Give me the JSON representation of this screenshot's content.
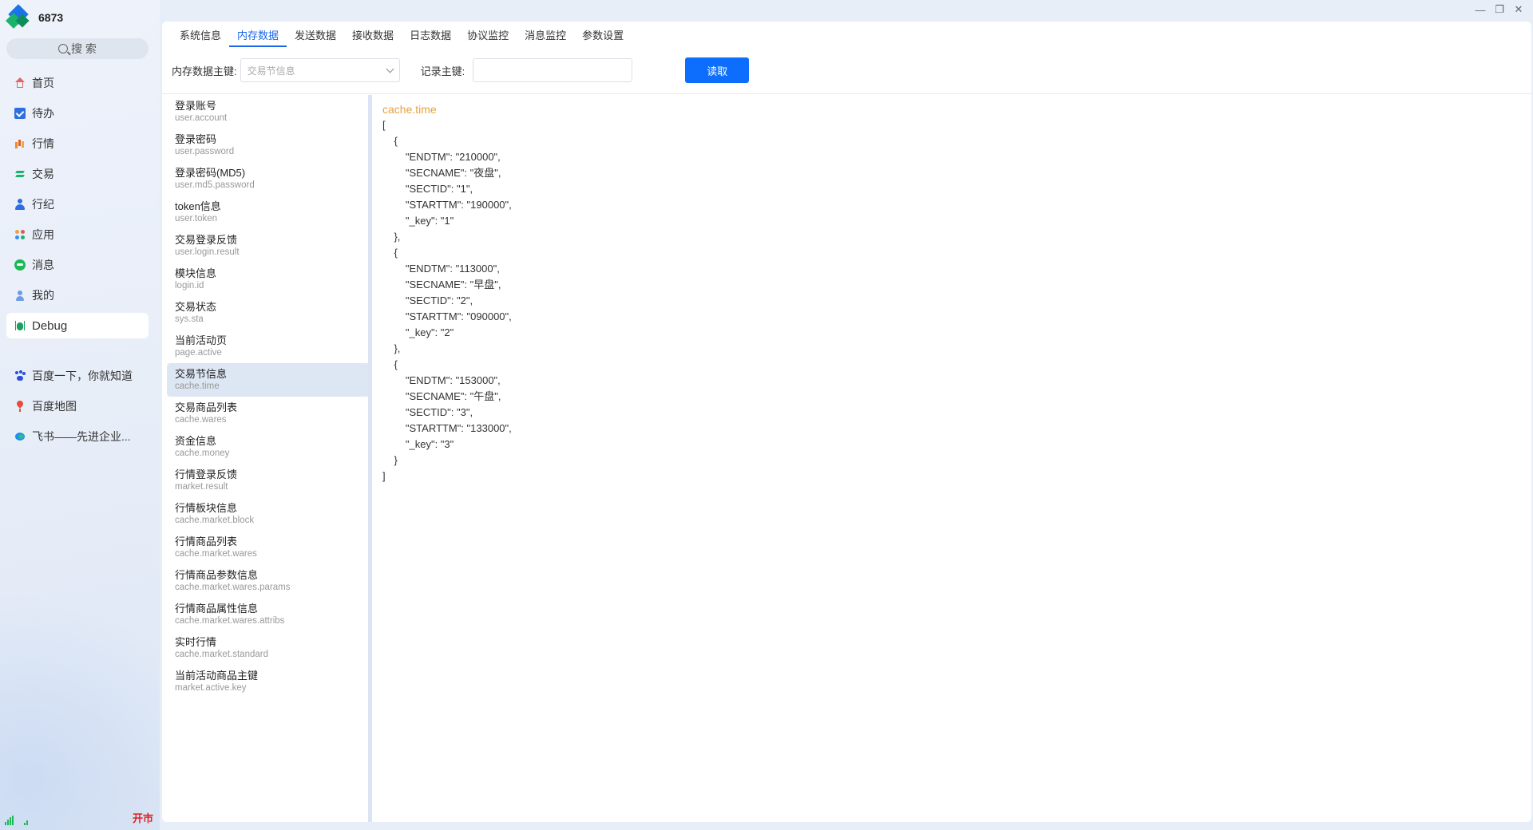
{
  "app": {
    "title": "6873"
  },
  "window_controls": [
    "—",
    "❐",
    "✕"
  ],
  "sidebar": {
    "search_placeholder": "搜 索",
    "nav": [
      {
        "label": "首页",
        "icon": "home-icon"
      },
      {
        "label": "待办",
        "icon": "todo-icon"
      },
      {
        "label": "行情",
        "icon": "market-icon"
      },
      {
        "label": "交易",
        "icon": "trade-icon"
      },
      {
        "label": "行纪",
        "icon": "user-icon"
      },
      {
        "label": "应用",
        "icon": "apps-icon"
      },
      {
        "label": "消息",
        "icon": "message-icon"
      },
      {
        "label": "我的",
        "icon": "mine-icon"
      },
      {
        "label": "Debug",
        "icon": "bug-icon",
        "active": true
      }
    ],
    "links": [
      {
        "label": "百度一下，你就知道",
        "icon": "baidu-icon"
      },
      {
        "label": "百度地图",
        "icon": "map-pin-icon"
      },
      {
        "label": "飞书——先进企业...",
        "icon": "feishu-icon"
      }
    ],
    "status": {
      "market_open": "开市"
    }
  },
  "tabs": [
    {
      "label": "系统信息"
    },
    {
      "label": "内存数据",
      "active": true
    },
    {
      "label": "发送数据"
    },
    {
      "label": "接收数据"
    },
    {
      "label": "日志数据"
    },
    {
      "label": "协议监控"
    },
    {
      "label": "消息监控"
    },
    {
      "label": "参数设置"
    }
  ],
  "toolbar": {
    "key_label": "内存数据主键:",
    "key_select_value": "交易节信息",
    "record_label": "记录主键:",
    "record_value": "",
    "read_button": "读取"
  },
  "key_list": [
    {
      "name": "登录账号",
      "path": "user.account"
    },
    {
      "name": "登录密码",
      "path": "user.password"
    },
    {
      "name": "登录密码(MD5)",
      "path": "user.md5.password"
    },
    {
      "name": "token信息",
      "path": "user.token"
    },
    {
      "name": "交易登录反馈",
      "path": "user.login.result"
    },
    {
      "name": "模块信息",
      "path": "login.id"
    },
    {
      "name": "交易状态",
      "path": "sys.sta"
    },
    {
      "name": "当前活动页",
      "path": "page.active"
    },
    {
      "name": "交易节信息",
      "path": "cache.time",
      "selected": true
    },
    {
      "name": "交易商品列表",
      "path": "cache.wares"
    },
    {
      "name": "资金信息",
      "path": "cache.money"
    },
    {
      "name": "行情登录反馈",
      "path": "market.result"
    },
    {
      "name": "行情板块信息",
      "path": "cache.market.block"
    },
    {
      "name": "行情商品列表",
      "path": "cache.market.wares"
    },
    {
      "name": "行情商品参数信息",
      "path": "cache.market.wares.params"
    },
    {
      "name": "行情商品属性信息",
      "path": "cache.market.wares.attribs"
    },
    {
      "name": "实时行情",
      "path": "cache.market.standard"
    },
    {
      "name": "当前活动商品主键",
      "path": "market.active.key"
    }
  ],
  "json_view": {
    "title": "cache.time",
    "content": "[\n    {\n        \"ENDTM\": \"210000\",\n        \"SECNAME\": \"夜盘\",\n        \"SECTID\": \"1\",\n        \"STARTTM\": \"190000\",\n        \"_key\": \"1\"\n    },\n    {\n        \"ENDTM\": \"113000\",\n        \"SECNAME\": \"早盘\",\n        \"SECTID\": \"2\",\n        \"STARTTM\": \"090000\",\n        \"_key\": \"2\"\n    },\n    {\n        \"ENDTM\": \"153000\",\n        \"SECNAME\": \"午盘\",\n        \"SECTID\": \"3\",\n        \"STARTTM\": \"133000\",\n        \"_key\": \"3\"\n    }\n]"
  }
}
